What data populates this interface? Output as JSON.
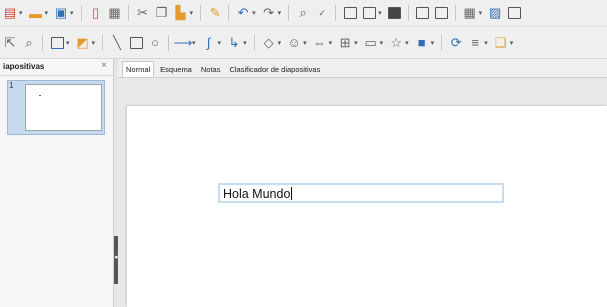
{
  "toolbar_primary": {
    "icons": [
      "new-icon",
      "open-icon",
      "save-icon",
      "export-pdf-icon",
      "print-icon",
      "cut-icon",
      "copy-icon",
      "paste-icon",
      "clone-format-icon",
      "undo-icon",
      "redo-icon",
      "find-replace-icon",
      "spelling-icon",
      "grid-icon",
      "display-views-icon",
      "master-slide-icon",
      "start-slideshow-icon",
      "slide-layout-icon",
      "table-icon",
      "image-icon",
      "chart-icon"
    ]
  },
  "toolbar_drawing": {
    "icons": [
      "select-icon",
      "zoom-icon",
      "line-color-icon",
      "fill-color-icon",
      "line-icon",
      "rectangle-icon",
      "ellipse-icon",
      "arrow-line-icon",
      "curve-icon",
      "connector-icon",
      "basic-shapes-icon",
      "symbol-shapes-icon",
      "block-arrows-icon",
      "flowchart-icon",
      "callouts-icon",
      "stars-icon",
      "3d-objects-icon",
      "rotate-icon",
      "align-icon",
      "arrange-icon"
    ]
  },
  "sidebar": {
    "title": "iapositivas",
    "close_glyph": "×",
    "slides": [
      {
        "number": "1"
      }
    ]
  },
  "tabs": [
    {
      "label": "Normal",
      "active": true
    },
    {
      "label": "Esquema",
      "active": false
    },
    {
      "label": "Notas",
      "active": false
    },
    {
      "label": "Clasificador de diapositivas",
      "active": false
    }
  ],
  "slide": {
    "textbox": {
      "value": "Hola Mundo"
    }
  }
}
